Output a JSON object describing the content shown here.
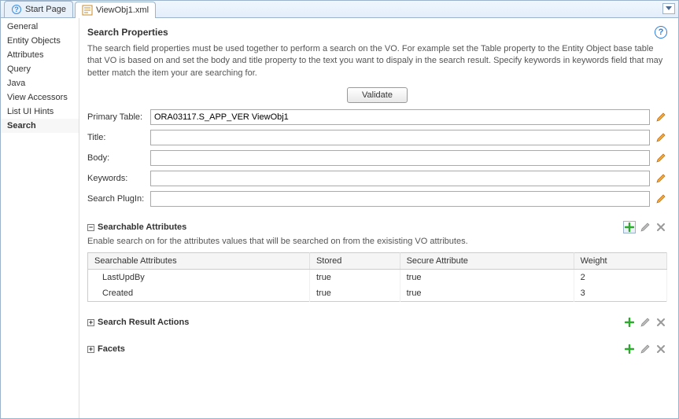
{
  "tabs": {
    "start": "Start Page",
    "file": "ViewObj1.xml"
  },
  "sidebar": {
    "items": [
      {
        "label": "General"
      },
      {
        "label": "Entity Objects"
      },
      {
        "label": "Attributes"
      },
      {
        "label": "Query"
      },
      {
        "label": "Java"
      },
      {
        "label": "View Accessors"
      },
      {
        "label": "List UI Hints"
      },
      {
        "label": "Search"
      }
    ]
  },
  "page": {
    "title": "Search Properties",
    "description": "The search field properties must be used together to perform a search on the VO. For example set the Table property to the Entity Object base table that VO is based on and set the body and title property to the text you want to dispaly in the search result. Specify keywords in keywords field that may better match the item your are searching for.",
    "validate": "Validate"
  },
  "form": {
    "primary_table": {
      "label": "Primary Table:",
      "value": "ORA03117.S_APP_VER ViewObj1"
    },
    "title": {
      "label": "Title:",
      "value": ""
    },
    "body": {
      "label": "Body:",
      "value": ""
    },
    "keywords": {
      "label": "Keywords:",
      "value": ""
    },
    "search_plugin": {
      "label": "Search PlugIn:",
      "value": ""
    }
  },
  "sections": {
    "searchable": {
      "title": "Searchable Attributes",
      "desc": "Enable search on for the attributes values that will be searched on from the exisisting VO attributes.",
      "columns": [
        "Searchable Attributes",
        "Stored",
        "Secure Attribute",
        "Weight"
      ],
      "rows": [
        {
          "name": "LastUpdBy",
          "stored": "true",
          "secure": "true",
          "weight": "2"
        },
        {
          "name": "Created",
          "stored": "true",
          "secure": "true",
          "weight": "3"
        }
      ]
    },
    "result_actions": {
      "title": "Search Result Actions"
    },
    "facets": {
      "title": "Facets"
    }
  }
}
